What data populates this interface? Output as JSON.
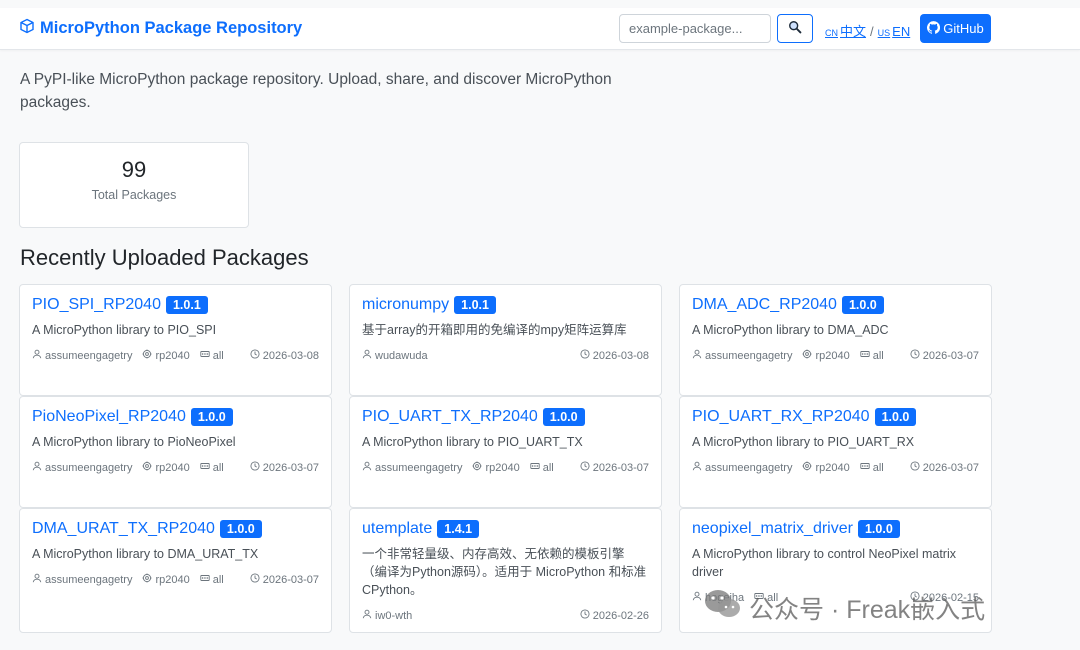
{
  "header": {
    "brand": "MicroPython Package Repository",
    "search_placeholder": "example-package...",
    "lang_cn_flag": "CN",
    "lang_cn": "中文",
    "lang_sep": "/",
    "lang_en_flag": "US",
    "lang_en": "EN",
    "github": "GitHub",
    "accent_color": "#0d6efd"
  },
  "intro": "A PyPI-like MicroPython package repository. Upload, share, and discover MicroPython packages.",
  "stats": {
    "total": "99",
    "label": "Total Packages"
  },
  "section_title": "Recently Uploaded Packages",
  "packages": [
    {
      "name": "PIO_SPI_RP2040",
      "version": "1.0.1",
      "description": "A MicroPython library to PIO_SPI",
      "author": "assumeengagetry",
      "chip": "rp2040",
      "board": "all",
      "date": "2026-03-08"
    },
    {
      "name": "micronumpy",
      "version": "1.0.1",
      "description": "基于array的开箱即用的免编译的mpy矩阵运算库",
      "author": "wudawuda",
      "chip": "",
      "board": "",
      "date": "2026-03-08"
    },
    {
      "name": "DMA_ADC_RP2040",
      "version": "1.0.0",
      "description": "A MicroPython library to DMA_ADC",
      "author": "assumeengagetry",
      "chip": "rp2040",
      "board": "all",
      "date": "2026-03-07"
    },
    {
      "name": "PioNeoPixel_RP2040",
      "version": "1.0.0",
      "description": "A MicroPython library to PioNeoPixel",
      "author": "assumeengagetry",
      "chip": "rp2040",
      "board": "all",
      "date": "2026-03-07"
    },
    {
      "name": "PIO_UART_TX_RP2040",
      "version": "1.0.0",
      "description": "A MicroPython library to PIO_UART_TX",
      "author": "assumeengagetry",
      "chip": "rp2040",
      "board": "all",
      "date": "2026-03-07"
    },
    {
      "name": "PIO_UART_RX_RP2040",
      "version": "1.0.0",
      "description": "A MicroPython library to PIO_UART_RX",
      "author": "assumeengagetry",
      "chip": "rp2040",
      "board": "all",
      "date": "2026-03-07"
    },
    {
      "name": "DMA_URAT_TX_RP2040",
      "version": "1.0.0",
      "description": "A MicroPython library to DMA_URAT_TX",
      "author": "assumeengagetry",
      "chip": "rp2040",
      "board": "all",
      "date": "2026-03-07"
    },
    {
      "name": "utemplate",
      "version": "1.4.1",
      "description": "一个非常轻量级、内存高效、无依赖的模板引擎（编译为Python源码）。适用于 MicroPython 和标准 CPython。",
      "author": "iw0-wth",
      "chip": "",
      "board": "",
      "date": "2026-02-26"
    },
    {
      "name": "neopixel_matrix_driver",
      "version": "1.0.0",
      "description": "A MicroPython library to control NeoPixel matrix driver",
      "author": "hogeiha",
      "chip": "",
      "board": "all",
      "date": "2026-02-15"
    }
  ],
  "watermark": "公众号 · Freak嵌入式"
}
